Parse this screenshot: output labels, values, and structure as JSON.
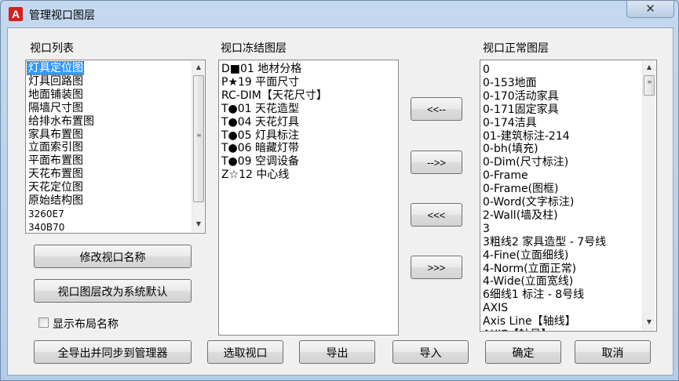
{
  "window": {
    "title": "管理视口图层",
    "app_icon_letter": "A",
    "close_symbol": "✕"
  },
  "viewport_list": {
    "label": "视口列表",
    "items": [
      "灯具定位图",
      "灯具回路图",
      "地面铺装图",
      "隔墙尺寸图",
      "给排水布置图",
      "家具布置图",
      "立面索引图",
      "平面布置图",
      "天花布置图",
      "天花定位图",
      "原始结构图",
      "3260E7",
      "340B70"
    ],
    "selected_index": 0
  },
  "frozen_layers": {
    "label": "视口冻结图层",
    "items": [
      "D■01 地材分格",
      "P★19 平面尺寸",
      "RC-DIM【天花尺寸】",
      "T●01 天花造型",
      "T●04 天花灯具",
      "T●05 灯具标注",
      "T●06 暗藏灯带",
      "T●09 空调设备",
      "Z☆12 中心线"
    ]
  },
  "normal_layers": {
    "label": "视口正常图层",
    "items": [
      "0",
      "0-153地面",
      "0-170活动家具",
      "0-171固定家具",
      "0-174洁具",
      "01-建筑标注-214",
      "0-bh(填充)",
      "0-Dim(尺寸标注)",
      "0-Frame",
      "0-Frame(图框)",
      "0-Word(文字标注)",
      "2-Wall(墙及柱)",
      "3",
      "3粗线2 家具造型  - 7号线",
      "4-Fine(立面细线)",
      "4-Norm(立面正常)",
      "4-Wide(立面宽线)",
      "6细线1 标注  - 8号线",
      "AXIS",
      "Axis Line【轴线】",
      "AXIS【轴号】"
    ]
  },
  "transfer_buttons": {
    "move_left": "<<--",
    "move_right": "-->>",
    "move_all_left": "<<<",
    "move_all_right": ">>>"
  },
  "buttons": {
    "rename_viewport": "修改视口名称",
    "reset_default": "视口图层改为系统默认",
    "export_sync": "全导出并同步到管理器",
    "pick_viewport": "选取视口",
    "export": "导出",
    "import": "导入",
    "ok": "确定",
    "cancel": "取消"
  },
  "show_layout_name": {
    "label": "显示布局名称",
    "checked": false
  },
  "colors": {
    "selection": "#3399ff",
    "dialog_bg": "#f0f0f0",
    "frame": "#b9d1ea"
  },
  "icons": [
    "autocad-app-icon",
    "close-icon",
    "scroll-up-icon",
    "scroll-down-icon",
    "scroll-grip-icon"
  ]
}
